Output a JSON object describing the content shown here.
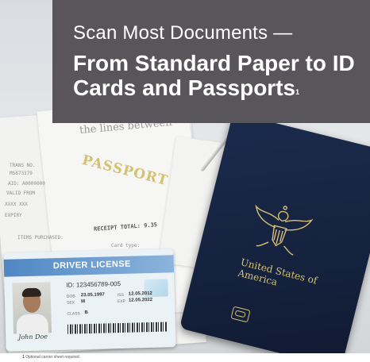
{
  "header": {
    "subtitle": "Scan Most Documents —",
    "title": "From Standard Paper to ID Cards and Passports",
    "title_superscript": "1"
  },
  "receipt": {
    "heading": "the lines between",
    "total_label": "RECEIPT TOTAL:",
    "total_value": "9.35",
    "lines": [
      "TRANS NO.",
      "MS873379",
      "AID: A0000000",
      "VALID FROM",
      "XXXX XXX",
      "EXPIRY",
      "ITEMS PURCHASED:",
      "Card type:"
    ]
  },
  "license": {
    "title": "DRIVER LICENSE",
    "id": "ID: 123456789-005",
    "dob_label": "DOB",
    "dob": "23.05.1997",
    "sex_label": "SEX",
    "sex": "M",
    "iss_label": "ISS",
    "iss": "12.05.2012",
    "exp_label": "EXP",
    "exp": "12.05.2022",
    "class_label": "CLASS",
    "class": "B",
    "signature": "John Doe"
  },
  "passport": {
    "label": "PASSPORT",
    "country": "United States of America"
  },
  "footnote": {
    "marker": "1",
    "text": "Optional carrier sheet required."
  },
  "colors": {
    "header_bg": "#58565a",
    "passport_blue": "#1b2b4c",
    "passport_gold": "#d6c072",
    "license_blue": "#4f87c4"
  }
}
